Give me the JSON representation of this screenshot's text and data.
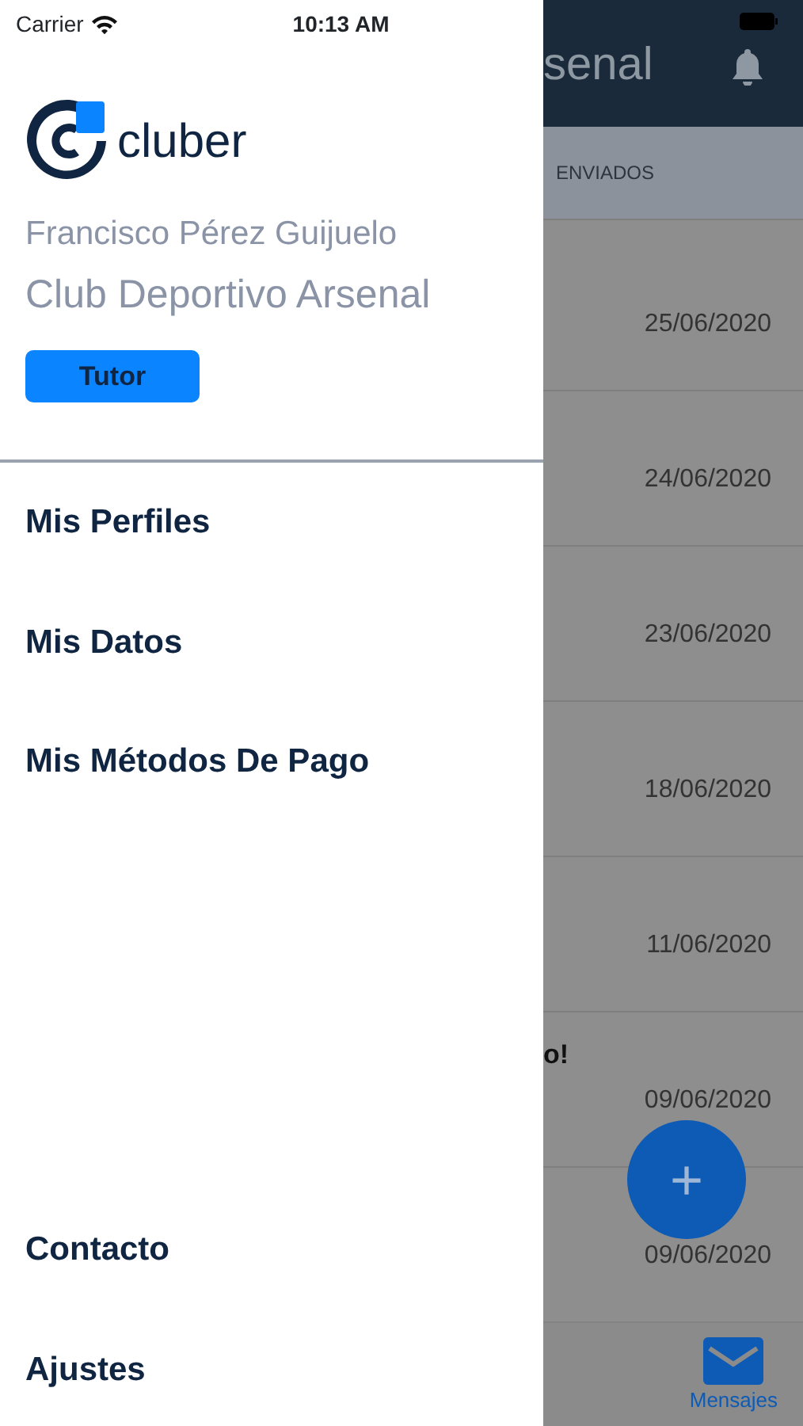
{
  "status_bar": {
    "carrier": "Carrier",
    "time": "10:13 AM"
  },
  "drawer": {
    "logo_text": "cluber",
    "user_name": "Francisco Pérez Guijuelo",
    "club": "Club Deportivo Arsenal",
    "role": "Tutor",
    "menu": [
      {
        "label": "Mis Perfiles"
      },
      {
        "label": "Mis Datos"
      },
      {
        "label": "Mis Métodos De Pago"
      }
    ],
    "footer_menu": [
      {
        "label": "Contacto"
      },
      {
        "label": "Ajustes"
      }
    ]
  },
  "background": {
    "title": "senal",
    "tab": "ENVIADOS",
    "rows": [
      {
        "snippet": "",
        "date": "25/06/2020"
      },
      {
        "snippet": "",
        "date": "24/06/2020"
      },
      {
        "snippet": "",
        "date": "23/06/2020"
      },
      {
        "snippet": "",
        "date": "18/06/2020"
      },
      {
        "snippet": "",
        "date": "11/06/2020"
      },
      {
        "snippet": "o!",
        "date": "09/06/2020"
      },
      {
        "snippet": "",
        "date": "09/06/2020"
      }
    ],
    "fab": "+",
    "tab_bar": [
      {
        "label": "Mensajes",
        "selected": true
      }
    ]
  }
}
